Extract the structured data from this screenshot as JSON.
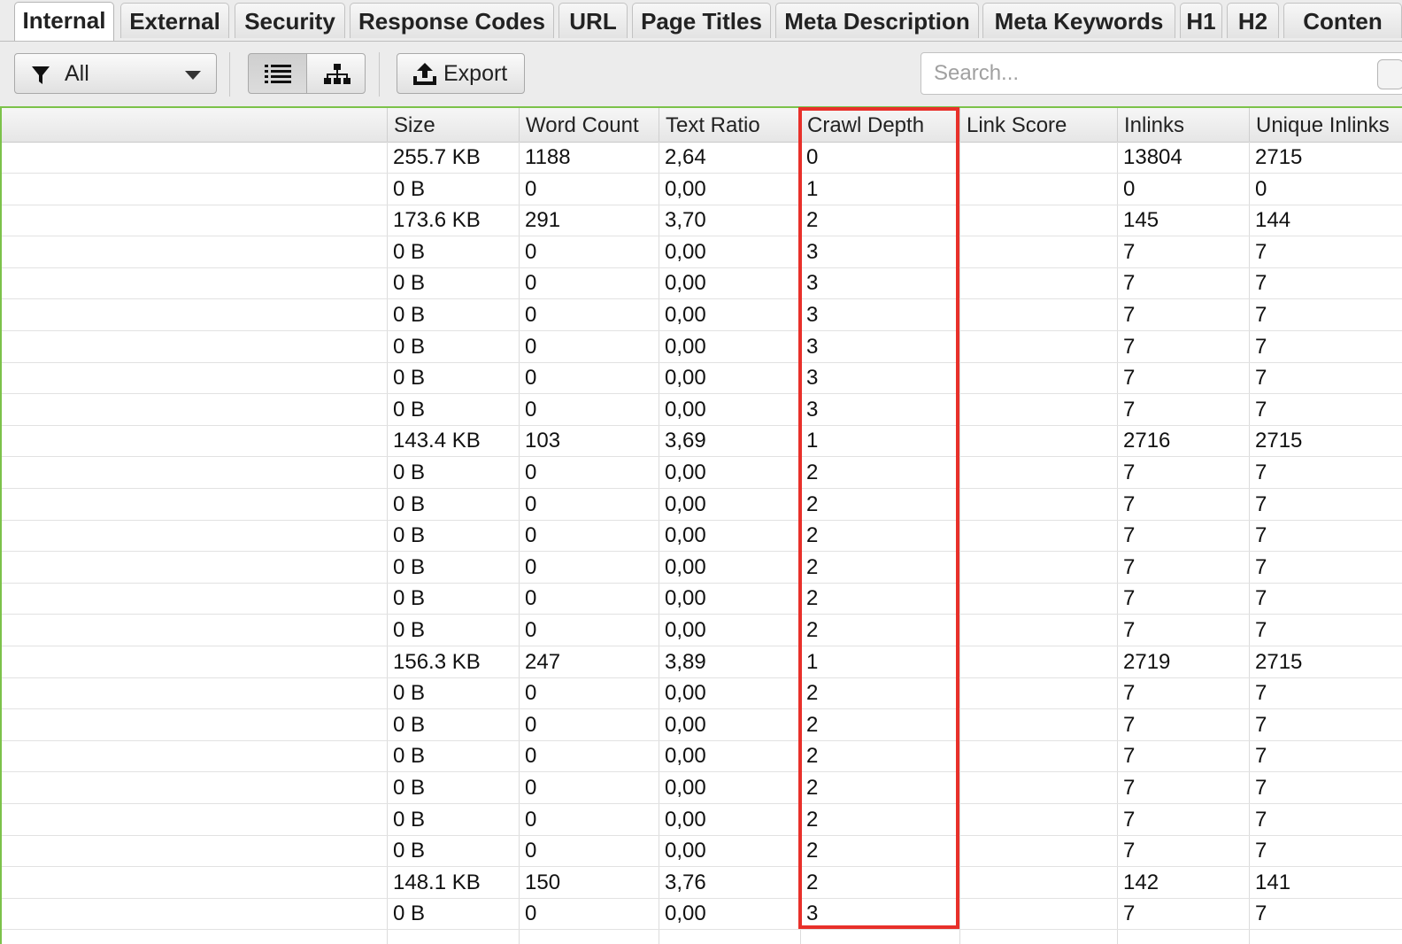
{
  "tabs": [
    {
      "label": "Internal",
      "active": true
    },
    {
      "label": "External"
    },
    {
      "label": "Security"
    },
    {
      "label": "Response Codes"
    },
    {
      "label": "URL"
    },
    {
      "label": "Page Titles"
    },
    {
      "label": "Meta Description"
    },
    {
      "label": "Meta Keywords"
    },
    {
      "label": "H1"
    },
    {
      "label": "H2"
    },
    {
      "label": "Conten"
    }
  ],
  "toolbar": {
    "filter_value": "All",
    "export_label": "Export",
    "search_placeholder": "Search...",
    "view_mode": "list"
  },
  "table": {
    "columns": [
      "",
      "Size",
      "Word Count",
      "Text Ratio",
      "Crawl Depth",
      "Link Score",
      "Inlinks",
      "Unique Inlinks"
    ],
    "highlighted_column": "Crawl Depth",
    "highlight_color": "#e8302a",
    "rows": [
      [
        "",
        "255.7 KB",
        "1188",
        "2,64",
        "0",
        "",
        "13804",
        "2715"
      ],
      [
        "",
        "0 B",
        "0",
        "0,00",
        "1",
        "",
        "0",
        "0"
      ],
      [
        "",
        "173.6 KB",
        "291",
        "3,70",
        "2",
        "",
        "145",
        "144"
      ],
      [
        "",
        "0 B",
        "0",
        "0,00",
        "3",
        "",
        "7",
        "7"
      ],
      [
        "",
        "0 B",
        "0",
        "0,00",
        "3",
        "",
        "7",
        "7"
      ],
      [
        "",
        "0 B",
        "0",
        "0,00",
        "3",
        "",
        "7",
        "7"
      ],
      [
        "",
        "0 B",
        "0",
        "0,00",
        "3",
        "",
        "7",
        "7"
      ],
      [
        "",
        "0 B",
        "0",
        "0,00",
        "3",
        "",
        "7",
        "7"
      ],
      [
        "",
        "0 B",
        "0",
        "0,00",
        "3",
        "",
        "7",
        "7"
      ],
      [
        "",
        "143.4 KB",
        "103",
        "3,69",
        "1",
        "",
        "2716",
        "2715"
      ],
      [
        "",
        "0 B",
        "0",
        "0,00",
        "2",
        "",
        "7",
        "7"
      ],
      [
        "",
        "0 B",
        "0",
        "0,00",
        "2",
        "",
        "7",
        "7"
      ],
      [
        "",
        "0 B",
        "0",
        "0,00",
        "2",
        "",
        "7",
        "7"
      ],
      [
        "",
        "0 B",
        "0",
        "0,00",
        "2",
        "",
        "7",
        "7"
      ],
      [
        "",
        "0 B",
        "0",
        "0,00",
        "2",
        "",
        "7",
        "7"
      ],
      [
        "",
        "0 B",
        "0",
        "0,00",
        "2",
        "",
        "7",
        "7"
      ],
      [
        "",
        "156.3 KB",
        "247",
        "3,89",
        "1",
        "",
        "2719",
        "2715"
      ],
      [
        "",
        "0 B",
        "0",
        "0,00",
        "2",
        "",
        "7",
        "7"
      ],
      [
        "",
        "0 B",
        "0",
        "0,00",
        "2",
        "",
        "7",
        "7"
      ],
      [
        "",
        "0 B",
        "0",
        "0,00",
        "2",
        "",
        "7",
        "7"
      ],
      [
        "",
        "0 B",
        "0",
        "0,00",
        "2",
        "",
        "7",
        "7"
      ],
      [
        "",
        "0 B",
        "0",
        "0,00",
        "2",
        "",
        "7",
        "7"
      ],
      [
        "",
        "0 B",
        "0",
        "0,00",
        "2",
        "",
        "7",
        "7"
      ],
      [
        "",
        "148.1 KB",
        "150",
        "3,76",
        "2",
        "",
        "142",
        "141"
      ],
      [
        "",
        "0 B",
        "0",
        "0,00",
        "3",
        "",
        "7",
        "7"
      ]
    ]
  },
  "icons": {
    "filter": "filter-icon",
    "dropdown": "chevron-down-icon",
    "list_view": "list-view-icon",
    "tree_view": "tree-view-icon",
    "export": "export-icon"
  }
}
